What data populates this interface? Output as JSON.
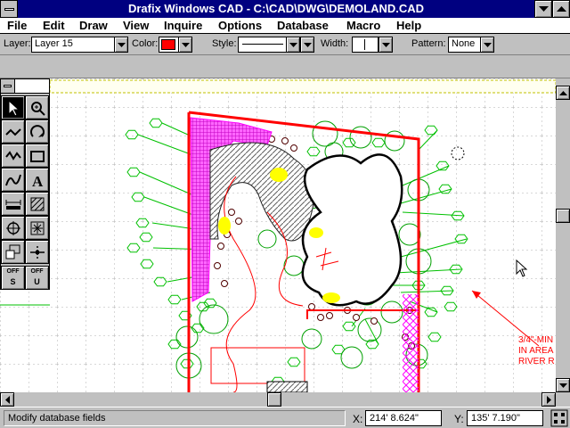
{
  "window": {
    "title": "Drafix Windows CAD - C:\\CAD\\DWG\\DEMOLAND.CAD"
  },
  "menu": {
    "items": [
      "File",
      "Edit",
      "Draw",
      "View",
      "Inquire",
      "Options",
      "Database",
      "Macro",
      "Help"
    ]
  },
  "properties": {
    "layer_label": "Layer:",
    "layer_value": "Layer 15",
    "color_label": "Color:",
    "color_value": "#ff0000",
    "style_label": "Style:",
    "width_label": "Width:",
    "pattern_label": "Pattern:",
    "pattern_value": "None"
  },
  "palette": {
    "tools": [
      {
        "name": "pointer-tool-icon",
        "selected": true
      },
      {
        "name": "zoom-tool-icon",
        "selected": false
      },
      {
        "name": "polyline-tool-icon",
        "selected": false
      },
      {
        "name": "arc-tool-icon",
        "selected": false
      },
      {
        "name": "curve-tool-icon",
        "selected": false
      },
      {
        "name": "rectangle-tool-icon",
        "selected": false
      },
      {
        "name": "spline-tool-icon",
        "selected": false
      },
      {
        "name": "text-tool-icon",
        "selected": false
      },
      {
        "name": "dimension-tool-icon",
        "selected": false
      },
      {
        "name": "hatch-tool-icon",
        "selected": false
      },
      {
        "name": "snap-point-tool-icon",
        "selected": false
      },
      {
        "name": "symbol-tool-icon",
        "selected": false
      },
      {
        "name": "layer-move-tool-icon",
        "selected": false
      },
      {
        "name": "trim-tool-icon",
        "selected": false
      }
    ],
    "toggle_snap": {
      "top": "OFF",
      "letter": "S"
    },
    "toggle_ortho": {
      "top": "OFF",
      "letter": "U"
    }
  },
  "drawing": {
    "annotation_lines": [
      "3/4\"-MIN",
      "IN AREA",
      "RIVER R"
    ]
  },
  "status": {
    "message": "Modify database fields",
    "x_label": "X:",
    "x_value": "214' 8.624\"",
    "y_label": "Y:",
    "y_value": "135' 7.190\""
  },
  "colors": {
    "titlebar": "#000080",
    "plant": "#00c000",
    "property_line": "#ff0000",
    "planting_bed": "#ff00ff",
    "accent": "#ffff00"
  }
}
